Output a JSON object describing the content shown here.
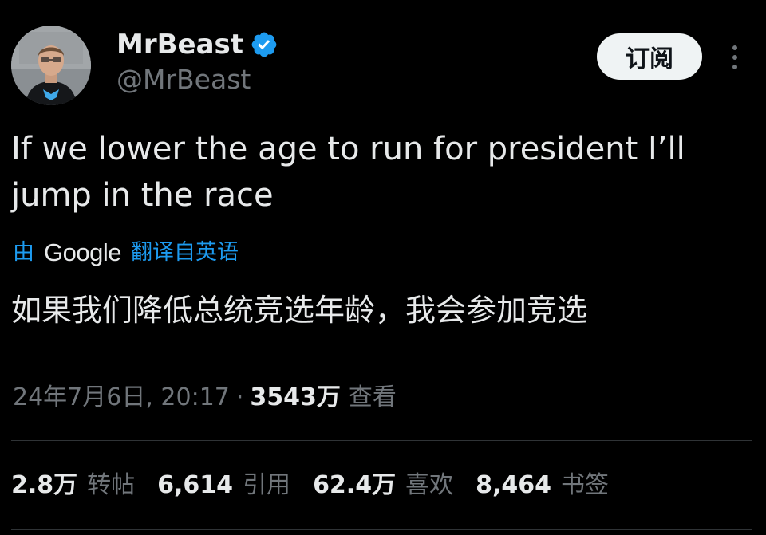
{
  "author": {
    "display_name": "MrBeast",
    "handle": "@MrBeast"
  },
  "header": {
    "subscribe_label": "订阅"
  },
  "tweet": {
    "text": "If we lower the age to run for president I’ll jump in the race",
    "translation_prefix": "由",
    "translation_provider": "Google",
    "translation_suffix": "翻译自英语",
    "translated_text": "如果我们降低总统竞选年龄，我会参加竞选"
  },
  "meta": {
    "timestamp": "24年7月6日, 20:17",
    "separator": "·",
    "views_count": "3543万",
    "views_label": "查看"
  },
  "stats": [
    {
      "count": "2.8万",
      "label": "转帖"
    },
    {
      "count": "6,614",
      "label": "引用"
    },
    {
      "count": "62.4万",
      "label": "喜欢"
    },
    {
      "count": "8,464",
      "label": "书签"
    }
  ],
  "colors": {
    "background": "#000000",
    "text_primary": "#e7e9ea",
    "text_secondary": "#71767b",
    "accent_blue": "#1d9bf0",
    "button_bg": "#eff3f4",
    "divider": "#2f3336"
  },
  "icons": {
    "verified": "verified-badge-icon",
    "more": "more-vertical-icon"
  }
}
